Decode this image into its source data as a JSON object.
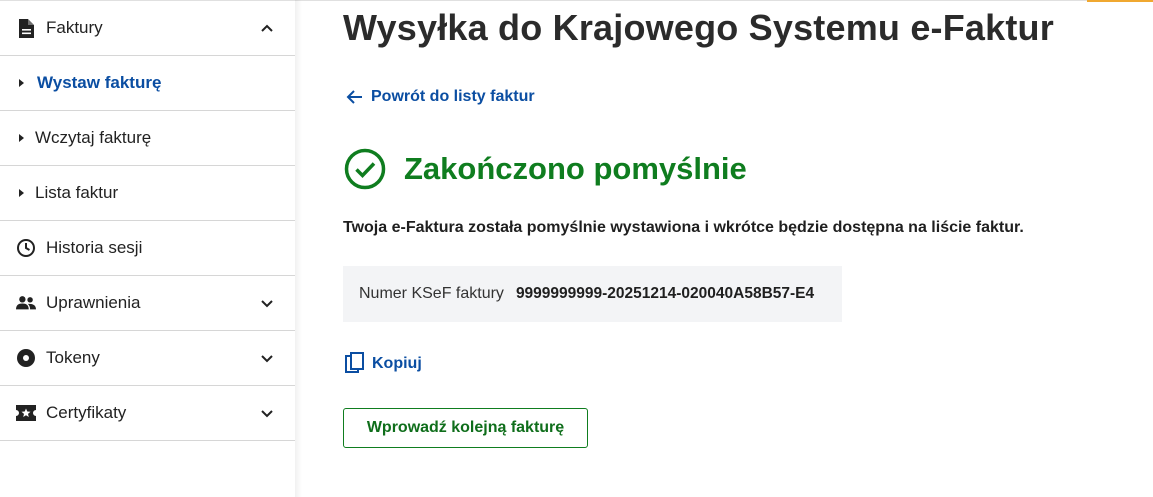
{
  "sidebar": {
    "section_faktury": {
      "label": "Faktury",
      "icon": "document-icon"
    },
    "sub_items": [
      {
        "label": "Wystaw fakturę",
        "active": true
      },
      {
        "label": "Wczytaj fakturę",
        "active": false
      },
      {
        "label": "Lista faktur",
        "active": false
      }
    ],
    "historia": {
      "label": "Historia sesji",
      "icon": "clock-icon"
    },
    "uprawnienia": {
      "label": "Uprawnienia",
      "icon": "people-icon"
    },
    "tokeny": {
      "label": "Tokeny",
      "icon": "token-icon"
    },
    "certyfikaty": {
      "label": "Certyfikaty",
      "icon": "certificate-icon"
    }
  },
  "main": {
    "title": "Wysyłka do Krajowego Systemu e-Faktur",
    "back_link": "Powrót do listy faktur",
    "success_title": "Zakończono pomyślnie",
    "description": "Twoja e-Faktura została pomyślnie wystawiona i wkrótce będzie dostępna na liście faktur.",
    "ksef_label": "Numer KSeF faktury",
    "ksef_number": "9999999999-20251214-020040A58B57-E4",
    "copy_label": "Kopiuj",
    "new_invoice_button": "Wprowadź kolejną fakturę"
  },
  "colors": {
    "link_blue": "#0b4ea2",
    "success_green": "#0f7d1f",
    "box_background": "#f3f4f6"
  }
}
